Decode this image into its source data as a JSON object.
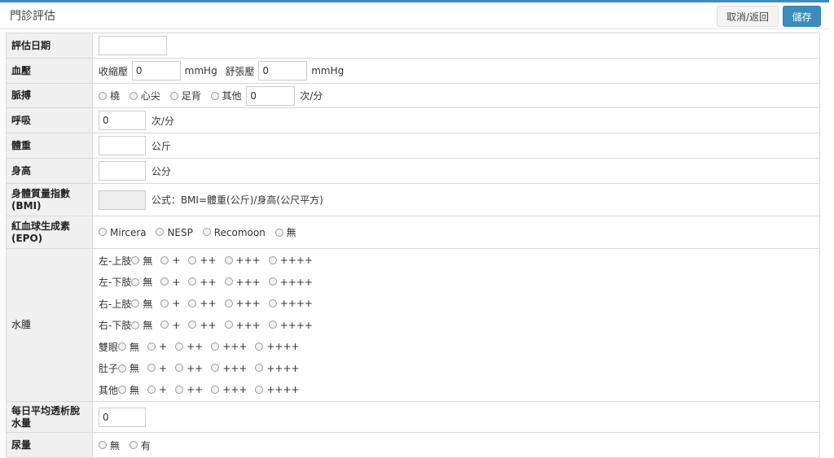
{
  "header": {
    "title": "門診評估",
    "cancel_label": "取消/返回",
    "save_label": "儲存"
  },
  "rows": {
    "date": {
      "label": "評估日期",
      "value": ""
    },
    "bp": {
      "label": "血壓",
      "systolic_label": "收縮壓",
      "systolic_value": "0",
      "diastolic_label": "舒張壓",
      "diastolic_value": "0",
      "unit": "mmHg"
    },
    "pulse": {
      "label": "脈搏",
      "options": [
        "橈",
        "心尖",
        "足背",
        "其他"
      ],
      "value": "0",
      "unit": "次/分"
    },
    "resp": {
      "label": "呼吸",
      "value": "0",
      "unit": "次/分"
    },
    "weight": {
      "label": "體重",
      "value": "",
      "unit": "公斤"
    },
    "height": {
      "label": "身高",
      "value": "",
      "unit": "公分"
    },
    "bmi": {
      "label_line1": "身體質量指數",
      "label_line2": "(BMI)",
      "value": "",
      "formula": "公式：BMI=體重(公斤)/身高(公尺平方)"
    },
    "epo": {
      "label_line1": "紅血球生成素",
      "label_line2": "(EPO)",
      "options": [
        "Mircera",
        "NESP",
        "Recomoon",
        "無"
      ]
    },
    "edema": {
      "label": "水腫",
      "levels": [
        "無",
        "+",
        "++",
        "+++",
        "++++"
      ],
      "parts": [
        "左-上肢",
        "左-下肢",
        "右-上肢",
        "右-下肢",
        "雙眼",
        "肚子",
        "其他"
      ]
    },
    "dialysis": {
      "label_line1": "每日平均透析脫",
      "label_line2": "水量",
      "value": "0"
    },
    "urine": {
      "label": "尿量",
      "options": [
        "無",
        "有"
      ]
    }
  }
}
